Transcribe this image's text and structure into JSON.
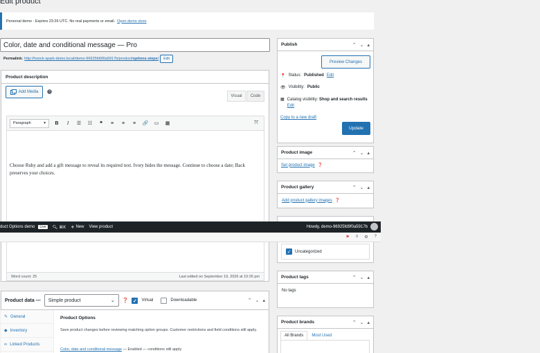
{
  "page": {
    "title": "Edit product"
  },
  "notice": {
    "text": "Personal demo · Expires 23:26 UTC. No real payments or email.",
    "link": "Open demo store"
  },
  "product": {
    "title": "Color, date and conditional message — Pro",
    "permalink_label": "Permalink:",
    "permalink_prefix": "http://hoock-spark-demo.local/demo-96925fd9f0a5917b/product/",
    "permalink_slug": "options-steps",
    "permalink_suffix": "/",
    "edit_label": "Edit"
  },
  "description": {
    "heading": "Product description",
    "add_media": "Add Media",
    "tab_visual": "Visual",
    "tab_code": "Code",
    "format": "Paragraph",
    "body": "Choose Ruby and add a gift message to reveal its required text. Ivory hides the message. Continue to choose a date; Back preserves your choices.",
    "word_count": "Word count: 25",
    "last_edited": "Last edited on September 19, 2026 at 10:26 pm"
  },
  "adminbar": {
    "site": "duct Options demo",
    "live": "Live",
    "search_shortcut": "⌘K",
    "new_label": "New",
    "view_label": "View product",
    "howdy": "Howdy, demo-96925fd9f0a5917b"
  },
  "publish": {
    "heading": "Publish",
    "preview": "Preview Changes",
    "status_label": "Status:",
    "status_value": "Published",
    "status_edit": "Edit",
    "visibility_label": "Visibility:",
    "visibility_value": "Public",
    "catalog_label": "Catalog visibility:",
    "catalog_value": "Shop and search results",
    "catalog_edit": "Edit",
    "copy_draft": "Copy to a new draft",
    "update": "Update"
  },
  "image_box": {
    "heading": "Product image",
    "link": "Set product image"
  },
  "gallery_box": {
    "heading": "Product gallery",
    "link": "Add product gallery images"
  },
  "categories": {
    "item": "Uncategorized"
  },
  "tags_box": {
    "heading": "Product tags",
    "empty": "No tags"
  },
  "brands_box": {
    "heading": "Product brands",
    "tab_all": "All Brands",
    "tab_used": "Most Used"
  },
  "product_data": {
    "heading": "Product data —",
    "type": "Simple product",
    "virtual": "Virtual",
    "downloadable": "Downloadable",
    "nav": [
      "General",
      "Inventory",
      "Linked Products"
    ],
    "options_title": "Product Options",
    "options_desc": "Save product changes before reviewing matching option groups. Customer restrictions and field conditions still apply.",
    "option_link": "Color, date and conditional message",
    "option_status": " — Enabled — conditions still apply"
  },
  "colors": {
    "accent": "#2271b1",
    "adminbar": "#1d2327",
    "background": "#f0f0f1"
  }
}
